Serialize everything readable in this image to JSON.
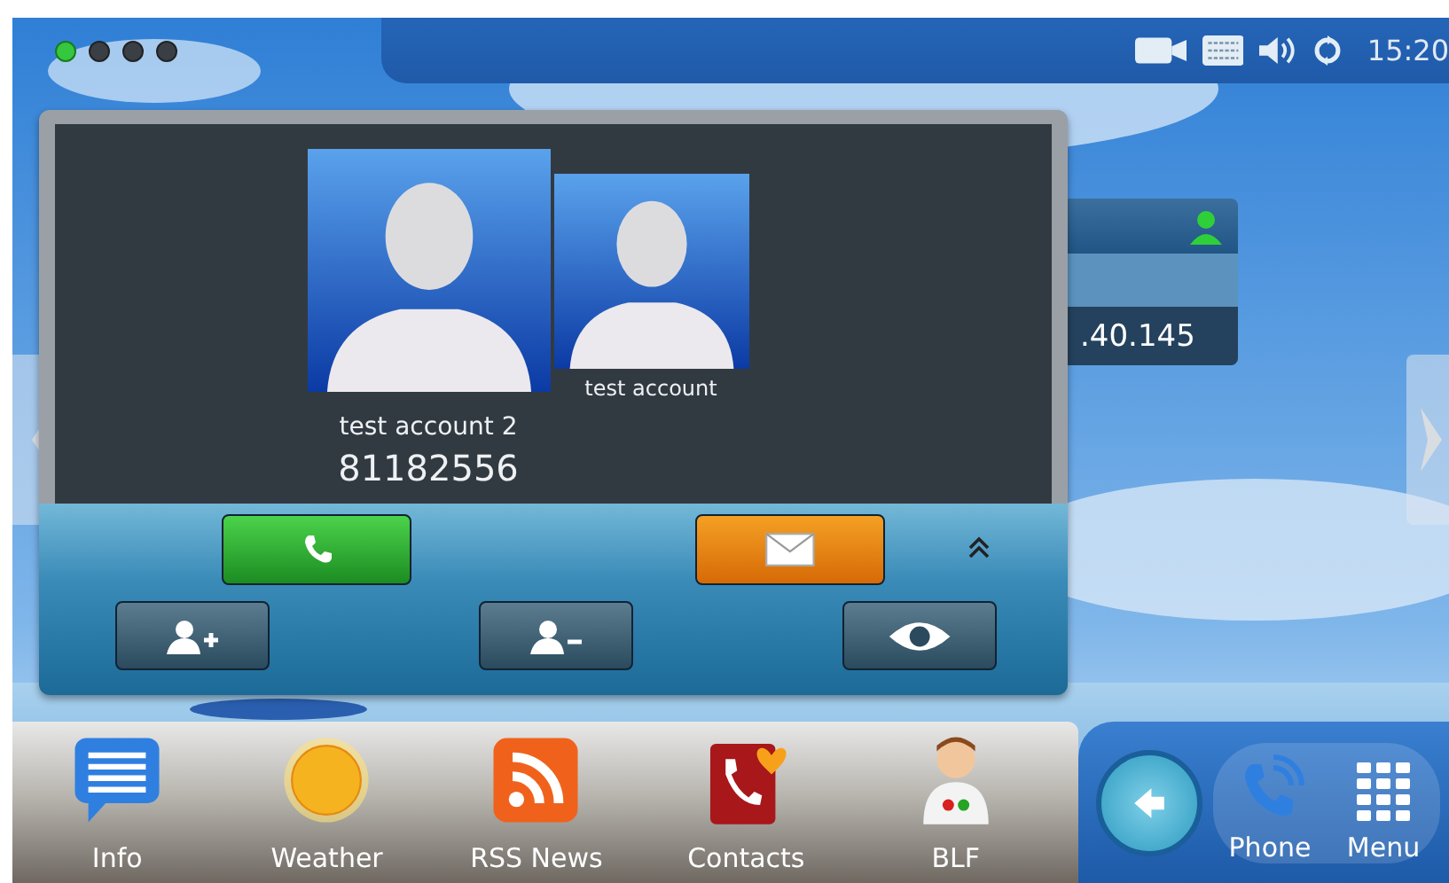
{
  "status_bar": {
    "pages": [
      {
        "selected": true
      },
      {
        "selected": false
      },
      {
        "selected": false
      },
      {
        "selected": false
      }
    ],
    "indicators": [
      {
        "kind": "camera"
      },
      {
        "kind": "keyboard"
      },
      {
        "kind": "speaker"
      },
      {
        "kind": "sync"
      }
    ],
    "time": "15:20"
  },
  "account_widget": {
    "address": ".40.145"
  },
  "call_popup": {
    "contacts": [
      {
        "name": "test account 2",
        "number": "81182556"
      },
      {
        "name": "test account"
      }
    ],
    "actions": [
      {
        "kind": "call"
      },
      {
        "kind": "message"
      },
      {
        "kind": "expand"
      },
      {
        "kind": "add-contact"
      },
      {
        "kind": "remove-contact"
      },
      {
        "kind": "view"
      }
    ]
  },
  "dock": {
    "apps": [
      {
        "label": "Info",
        "kind": "info"
      },
      {
        "label": "Weather",
        "kind": "weather"
      },
      {
        "label": "RSS News",
        "kind": "rss"
      },
      {
        "label": "Contacts",
        "kind": "contacts"
      },
      {
        "label": "BLF",
        "kind": "blf"
      }
    ],
    "soft_keys": [
      {
        "label": "Phone",
        "kind": "phone"
      },
      {
        "label": "Menu",
        "kind": "menu"
      }
    ]
  }
}
